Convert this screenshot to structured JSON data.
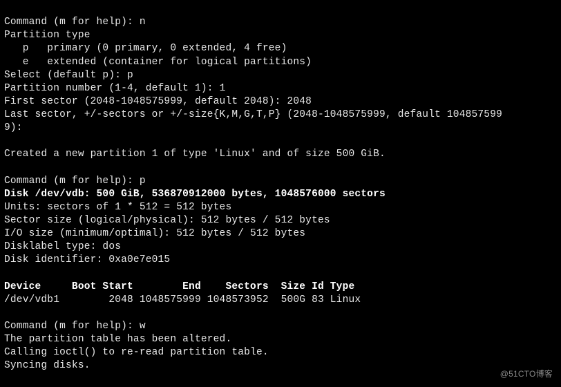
{
  "prompts": {
    "cmd1_prompt": "Command (m for help): ",
    "cmd1_input": "n",
    "ptype_header": "Partition type",
    "ptype_primary": "   p   primary (0 primary, 0 extended, 4 free)",
    "ptype_extended": "   e   extended (container for logical partitions)",
    "select_prompt": "Select (default p): ",
    "select_input": "p",
    "partnum_prompt": "Partition number (1-4, default 1): ",
    "partnum_input": "1",
    "first_sector_prompt": "First sector (2048-1048575999, default 2048): ",
    "first_sector_input": "2048",
    "last_sector_line1": "Last sector, +/-sectors or +/-size{K,M,G,T,P} (2048-1048575999, default 104857599",
    "last_sector_line2": "9): ",
    "created_msg": "Created a new partition 1 of type 'Linux' and of size 500 GiB.",
    "cmd2_prompt": "Command (m for help): ",
    "cmd2_input": "p",
    "cmd3_prompt": "Command (m for help): ",
    "cmd3_input": "w",
    "altered_msg": "The partition table has been altered.",
    "ioctl_msg": "Calling ioctl() to re-read partition table.",
    "syncing_msg": "Syncing disks."
  },
  "disk_info": {
    "disk_line": "Disk /dev/vdb: 500 GiB, 536870912000 bytes, 1048576000 sectors",
    "units": "Units: sectors of 1 * 512 = 512 bytes",
    "sector_size": "Sector size (logical/physical): 512 bytes / 512 bytes",
    "io_size": "I/O size (minimum/optimal): 512 bytes / 512 bytes",
    "disklabel": "Disklabel type: dos",
    "identifier": "Disk identifier: 0xa0e7e015"
  },
  "table": {
    "header": "Device     Boot Start        End    Sectors  Size Id Type",
    "row1": "/dev/vdb1        2048 1048575999 1048573952  500G 83 Linux"
  },
  "chart_data": {
    "type": "table",
    "title": "fdisk partition table for /dev/vdb",
    "columns": [
      "Device",
      "Boot",
      "Start",
      "End",
      "Sectors",
      "Size",
      "Id",
      "Type"
    ],
    "rows": [
      {
        "Device": "/dev/vdb1",
        "Boot": "",
        "Start": 2048,
        "End": 1048575999,
        "Sectors": 1048573952,
        "Size": "500G",
        "Id": "83",
        "Type": "Linux"
      }
    ],
    "disk": {
      "path": "/dev/vdb",
      "size_gib": 500,
      "bytes": 536870912000,
      "sectors": 1048576000,
      "sector_bytes": 512,
      "disklabel": "dos",
      "identifier": "0xa0e7e015"
    }
  },
  "watermark": "@51CTO博客"
}
